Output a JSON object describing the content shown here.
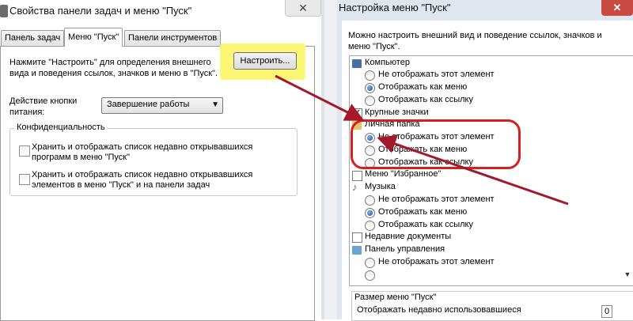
{
  "left_window": {
    "title": "Свойства панели задач и меню \"Пуск\"",
    "close_label": "✕",
    "tabs": [
      {
        "label": "Панель задач"
      },
      {
        "label": "Меню \"Пуск\""
      },
      {
        "label": "Панели инструментов"
      }
    ],
    "description": "Нажмите \"Настроить\" для определения внешнего вида и поведения ссылок, значков и меню в \"Пуск\".",
    "customize_button": "Настроить...",
    "power_label": "Действие кнопки питания:",
    "power_value": "Завершение работы",
    "privacy_title": "Конфиденциальность",
    "privacy_options": [
      "Хранить и отображать список недавно открывавшихся программ в меню \"Пуск\"",
      "Хранить и отображать список недавно открывавшихся элементов в меню \"Пуск\" и на панели задач"
    ]
  },
  "right_window": {
    "title": "Настройка меню \"Пуск\"",
    "close_label": "✕",
    "description": "Можно настроить внешний вид и поведение ссылок, значков и меню \"Пуск\".",
    "tree": {
      "computer": "Компьютер",
      "personal_folder": "Личная папка",
      "large_icons": "Крупные значки",
      "favorites": "Меню \"Избранное\"",
      "music": "Музыка",
      "recent_docs": "Недавние документы",
      "control_panel": "Панель управления",
      "opt_hide": "Не отображать этот элемент",
      "opt_menu": "Отображать как меню",
      "opt_link": "Отображать как ссылку"
    },
    "size_group_title": "Размер меню \"Пуск\"",
    "size_text": "Отображать недавно использовавшиеся",
    "size_value": "0"
  },
  "colors": {
    "highlight": "#fbf774",
    "annotation": "#d42020",
    "arrow": "#a3192a"
  }
}
